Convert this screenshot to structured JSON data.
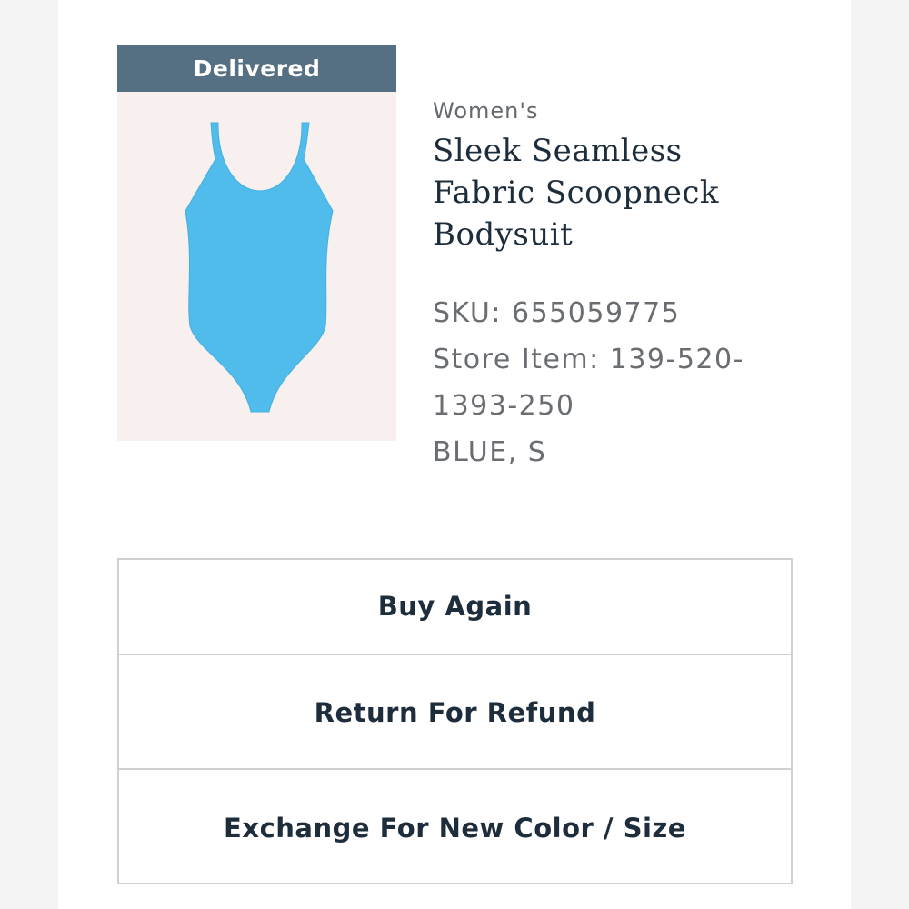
{
  "order_item": {
    "status": "Delivered",
    "image_icon": "bodysuit-product-image",
    "category": "Women's",
    "title_lines": [
      "Sleek Seamless",
      "Fabric Scoopneck",
      "Bodysuit"
    ],
    "sku": "SKU: 655059775",
    "store_item_line1": "Store Item: 139-520-",
    "store_item_line2": "1393-250",
    "variant": "BLUE, S"
  },
  "actions": {
    "buy_again": "Buy Again",
    "return_refund": "Return For Refund",
    "exchange": "Exchange For New Color / Size"
  },
  "colors": {
    "badge": "#557082",
    "text_dark": "#1d2d3c",
    "text_muted": "#6a6e72",
    "product": "#4fbcec",
    "image_bg": "#f8f0ee",
    "border": "#d0d0d0"
  }
}
